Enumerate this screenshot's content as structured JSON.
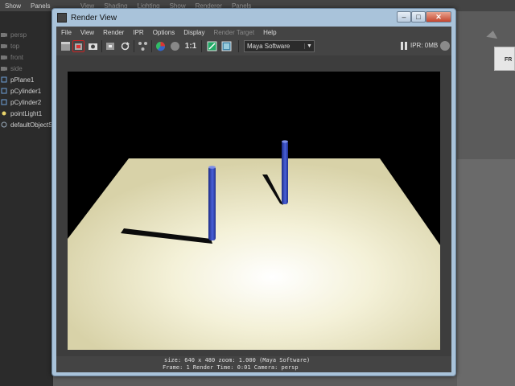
{
  "app": {
    "main_menu": [
      "Show",
      "Panels"
    ],
    "panel_menu": [
      "View",
      "Shading",
      "Lighting",
      "Show",
      "Renderer",
      "Panels"
    ],
    "viewcube_label": "FR"
  },
  "outliner": {
    "items": [
      {
        "label": "persp",
        "dim": true
      },
      {
        "label": "top",
        "dim": true
      },
      {
        "label": "front",
        "dim": true
      },
      {
        "label": "side",
        "dim": true
      },
      {
        "label": "pPlane1",
        "dim": false
      },
      {
        "label": "pCylinder1",
        "dim": false
      },
      {
        "label": "pCylinder2",
        "dim": false
      },
      {
        "label": "pointLight1",
        "dim": false
      },
      {
        "label": "defaultObjectS",
        "dim": false
      }
    ]
  },
  "render_window": {
    "title": "Render View",
    "menu": [
      {
        "label": "File",
        "disabled": false
      },
      {
        "label": "View",
        "disabled": false
      },
      {
        "label": "Render",
        "disabled": false
      },
      {
        "label": "IPR",
        "disabled": false
      },
      {
        "label": "Options",
        "disabled": false
      },
      {
        "label": "Display",
        "disabled": false
      },
      {
        "label": "Render Target",
        "disabled": true
      },
      {
        "label": "Help",
        "disabled": false
      }
    ],
    "toolbar": {
      "renderer": "Maya Software",
      "ratio_label": "1:1",
      "ipr_label": "IPR: 0MB"
    },
    "info": {
      "line1": "size: 640 x 480 zoom: 1.000      (Maya Software)",
      "line2": "Frame: 1       Render Time: 0:01        Camera: persp"
    }
  },
  "colors": {
    "titlebar": "#a9c3da",
    "client_bg": "#444444",
    "render_bg": "#000000",
    "plane": "#f4f1d8",
    "cylinder": "#3a4fc4",
    "close_button": "#c5462f"
  }
}
